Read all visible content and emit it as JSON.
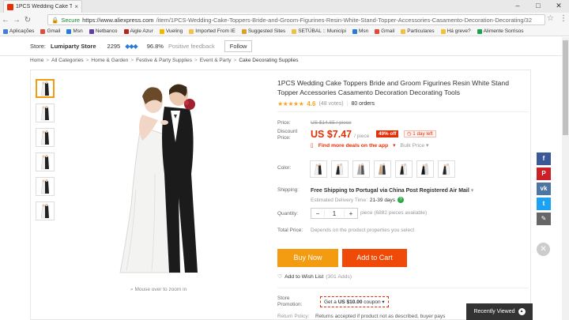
{
  "browser": {
    "tab_title": "1PCS Wedding Cake Top",
    "url_secure": "Secure",
    "url_host": "https://www.aliexpress.com",
    "url_path": "/item/1PCS-Wedding-Cake-Toppers-Bride-and-Groom-Figurines-Resin-White-Stand-Topper-Accessories-Casamento-Decoration-Decorating/32",
    "bookmarks": [
      "Aplicações",
      "Gmail",
      "Msn",
      "Netbanco",
      "Aigle Azur",
      "Vueling",
      "Imported From IE",
      "Suggested Sites",
      "SETÚBAL :: Municípi",
      "Msn",
      "Gmail",
      "Particulares",
      "Há greve?",
      "Alimente Sorrisos"
    ],
    "bookmark_colors": [
      "#4a7ad6",
      "#e04a3a",
      "#2a7bd6",
      "#5d3da8",
      "#b22",
      "#f3b700",
      "#f3c24a",
      "#d8a22a",
      "#f0c040",
      "#2a7bd6",
      "#e04a3a",
      "#f0c040",
      "#f0c040",
      "#1aa34a"
    ]
  },
  "store": {
    "label": "Store:",
    "name": "Lumiparty Store",
    "score": "2295",
    "feedback_pct": "96.8%",
    "feedback_label": "Positive feedback",
    "follow_label": "Follow"
  },
  "breadcrumb": [
    "Home",
    "All Categories",
    "Home & Garden",
    "Festive & Party Supplies",
    "Event & Party",
    "Cake Decorating Supplies"
  ],
  "product": {
    "title": "1PCS Wedding Cake Toppers Bride and Groom Figurines Resin White Stand Topper Accessories Casamento Decoration Decorating Tools",
    "rating": "4.6",
    "votes": "(48 votes)",
    "orders": "80 orders",
    "price_label": "Price:",
    "old_price": "US $14.65 / piece",
    "discount_label": "Discount Price:",
    "price": "US $7.47",
    "price_unit": "/ piece",
    "off_badge": "49% off",
    "time_left": "1 day left",
    "deals_link": "Find more deals on the app",
    "bulk_price": "Bulk Price",
    "color_label": "Color:",
    "shipping_label": "Shipping:",
    "shipping_text": "Free Shipping to Portugal via China Post Registered Air Mail",
    "est_label": "Estimated Delivery Time:",
    "est_days": "21-39 days",
    "qty_label": "Quantity:",
    "qty_minus": "−",
    "qty_value": "1",
    "qty_plus": "+",
    "qty_avail": "piece (6882 pieces available)",
    "total_label": "Total Price:",
    "total_value": "Depends on the product properties you select",
    "buy_now": "Buy Now",
    "add_to_cart": "Add to Cart",
    "wishlist": "Add to Wish List",
    "wish_count": "(301 Adds)",
    "store_promo_label": "Store Promotion:",
    "coupon_prefix": "Get a",
    "coupon_amount": "US $10.00",
    "coupon_suffix": "coupon",
    "return_label": "Return Policy:",
    "return_text": "Returns accepted if product not as described, buyer pays",
    "zoom_hint": "Mouse over to zoom in"
  },
  "social": [
    "f",
    "P",
    "vk",
    "t",
    "✎"
  ],
  "social_colors": [
    "#3b5998",
    "#cb2027",
    "#4c75a3",
    "#1da1f2",
    "#666"
  ],
  "recently_viewed": "Recently Viewed"
}
